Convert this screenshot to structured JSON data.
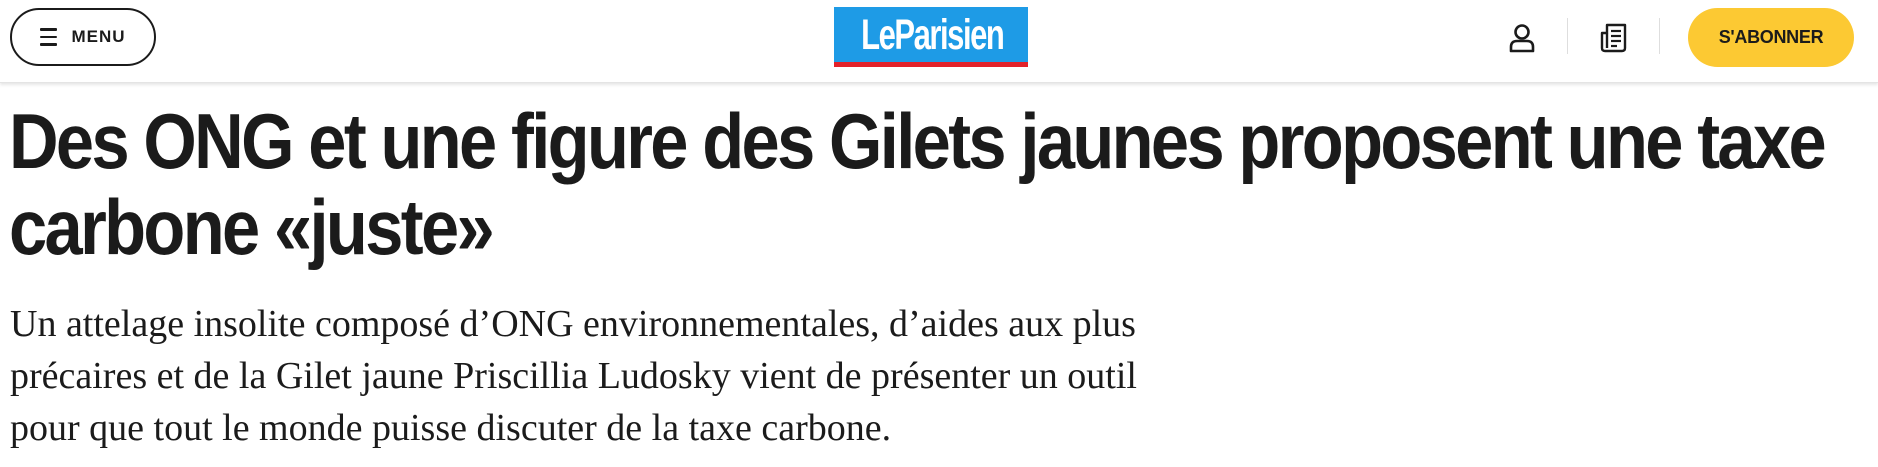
{
  "header": {
    "menu_label": "MENU",
    "logo_text": "LeParisien",
    "subscribe_label": "S'ABONNER",
    "icons": {
      "menu": "hamburger-icon",
      "account": "user-icon",
      "journal": "newspaper-icon"
    },
    "colors": {
      "logo_bg": "#1e9be6",
      "logo_bar": "#e2222a",
      "subscribe_bg": "#fcc933"
    }
  },
  "article": {
    "headline_lines": [
      "Des ONG et une figure des Gilets jaunes proposent une taxe",
      "carbone «juste»"
    ],
    "standfirst_lines": [
      "Un attelage insolite composé d’ONG environnementales, d’aides aux plus",
      "précaires et de la Gilet jaune Priscillia Ludosky vient de présenter un outil",
      "pour que tout le monde puisse discuter de la taxe carbone."
    ]
  }
}
